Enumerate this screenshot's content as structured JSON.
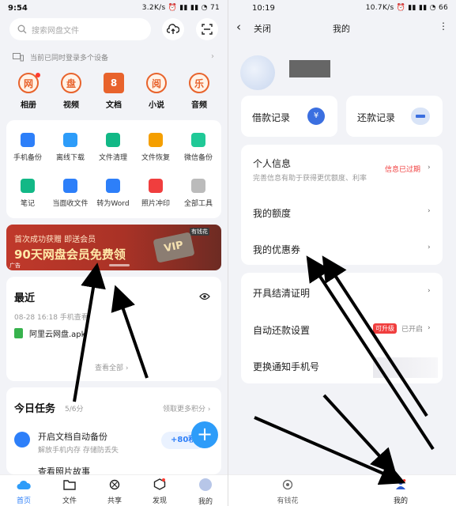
{
  "left": {
    "status": {
      "time": "9:54",
      "right": "3.2K/s ⏰ ▮▮ ▮▮ ◔ 71"
    },
    "search": {
      "placeholder": "搜索网盘文件"
    },
    "device_notice": "当前已同时登录多个设备",
    "categories": [
      {
        "glyph": "网",
        "label": "相册"
      },
      {
        "glyph": "盘",
        "label": "视频"
      },
      {
        "glyph": "8",
        "label": "文档"
      },
      {
        "glyph": "阅",
        "label": "小说"
      },
      {
        "glyph": "乐",
        "label": "音频"
      }
    ],
    "tools_row1": [
      {
        "label": "手机备份",
        "color": "#2d7ff9"
      },
      {
        "label": "离线下载",
        "color": "#2d9cf9"
      },
      {
        "label": "文件清理",
        "color": "#12b886"
      },
      {
        "label": "文件恢复",
        "color": "#f59f00"
      },
      {
        "label": "微信备份",
        "color": "#20c997"
      }
    ],
    "tools_row2": [
      {
        "label": "笔记",
        "color": "#12b886"
      },
      {
        "label": "当面收文件",
        "color": "#2d7ff9"
      },
      {
        "label": "转为Word",
        "color": "#2d7ff9"
      },
      {
        "label": "照片冲印",
        "color": "#f03e3e"
      },
      {
        "label": "全部工具",
        "color": "#bbb"
      }
    ],
    "banner": {
      "line1": "首次成功获赠 即送会员",
      "line2": "90天网盘会员免费领",
      "ad": "广告",
      "badge": "有钱花",
      "vip": "VIP"
    },
    "recent": {
      "title": "最近",
      "meta": "08-28 16:18  手机查看",
      "file": "阿里云网盘.apk",
      "view_all": "查看全部 ›"
    },
    "tasks": {
      "title": "今日任务",
      "count": "5/6分",
      "more": "领取更多积分 ›",
      "item1": "开启文档自动备份",
      "item1_sub": "解放手机内存 存储防丢失",
      "item1_reward": "+80积",
      "item2": "查看照片故事"
    },
    "nav": [
      {
        "label": "首页"
      },
      {
        "label": "文件"
      },
      {
        "label": "共享"
      },
      {
        "label": "发现"
      },
      {
        "label": "我的"
      }
    ]
  },
  "right": {
    "status": {
      "time": "10:19",
      "right": "10.7K/s ⏰ ▮▮ ▮▮ ◔ 66"
    },
    "header": {
      "close": "关闭",
      "title": "我的",
      "more": "⋮"
    },
    "loan_record": "借款记录",
    "repay_record": "还款记录",
    "personal_info": "个人信息",
    "personal_info_sub": "完善信息有助于获得更优额度、利率",
    "personal_info_status": "信息已过期",
    "my_quota": "我的额度",
    "my_coupons": "我的优惠券",
    "settlement": "开具结清证明",
    "auto_repay": "自动还款设置",
    "upgrade_badge": "可升级",
    "auto_repay_status": "已开启",
    "change_phone": "更换通知手机号",
    "nav": [
      {
        "label": "有钱花"
      },
      {
        "label": "我的"
      }
    ]
  },
  "colors": {
    "accent": "#2d7ff9",
    "orange": "#e8632c",
    "red": "#ff3b30"
  }
}
